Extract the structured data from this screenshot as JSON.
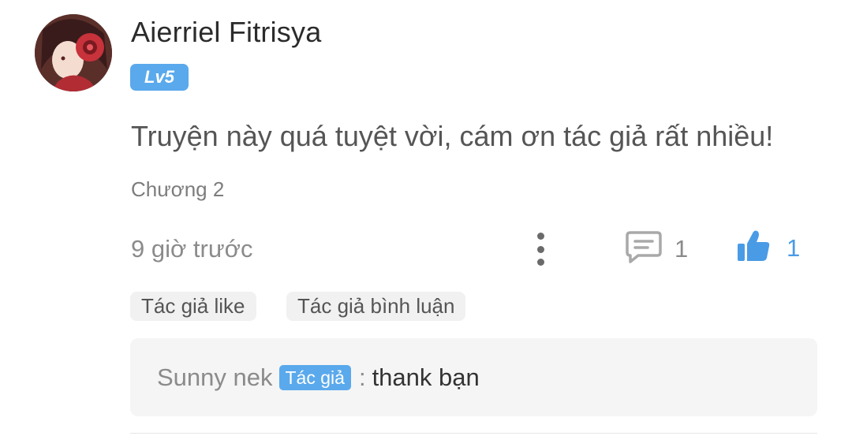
{
  "comment": {
    "username": "Aierriel Fitrisya",
    "level": "Lv5",
    "text": "Truyện này quá tuyệt vời, cám ơn tác giả rất nhiều!",
    "chapter": "Chương 2",
    "timestamp": "9 giờ trước",
    "reply_count": "1",
    "like_count": "1"
  },
  "chips": {
    "author_like": "Tác giả like",
    "author_reply": "Tác giả bình luận"
  },
  "reply": {
    "author": "Sunny nek",
    "author_tag": "Tác giả",
    "separator": ":",
    "text": "thank bạn"
  },
  "icons": {
    "more": "vertical-dots-icon",
    "reply": "comment-icon",
    "like": "thumbs-up-icon"
  },
  "colors": {
    "accent": "#5aa9ec",
    "like": "#4a9be6",
    "text_muted": "#8b8b8b"
  }
}
